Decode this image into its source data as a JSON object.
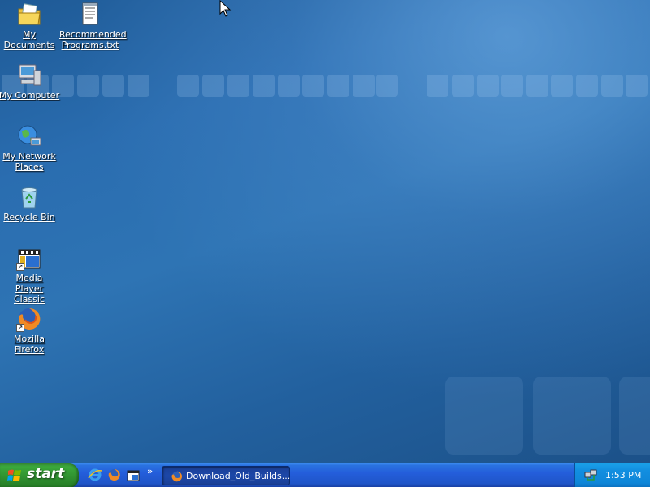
{
  "desktop": {
    "icons": [
      {
        "label": "My Documents",
        "icon": "my-documents-icon"
      },
      {
        "label": "Recommended Programs.txt",
        "icon": "text-file-icon"
      },
      {
        "label": "My Computer",
        "icon": "my-computer-icon"
      },
      {
        "label": "My Network Places",
        "icon": "network-places-icon"
      },
      {
        "label": "Recycle Bin",
        "icon": "recycle-bin-icon"
      },
      {
        "label": "Media Player Classic",
        "icon": "media-player-classic-icon"
      },
      {
        "label": "Mozilla Firefox",
        "icon": "firefox-icon"
      }
    ]
  },
  "taskbar": {
    "start_label": "start",
    "quick_launch": [
      "internet-explorer-icon",
      "firefox-icon",
      "media-player-classic-icon"
    ],
    "chevron": "»",
    "task_buttons": [
      {
        "label": "Download_Old_Builds...",
        "icon": "firefox-icon"
      }
    ],
    "tray": {
      "icon": "network-tray-icon",
      "clock": "1:53 PM"
    }
  },
  "colors": {
    "desktop": "#2a6db0",
    "taskbar": "#245edb",
    "start": "#3aa83a",
    "tray": "#128ee0"
  }
}
